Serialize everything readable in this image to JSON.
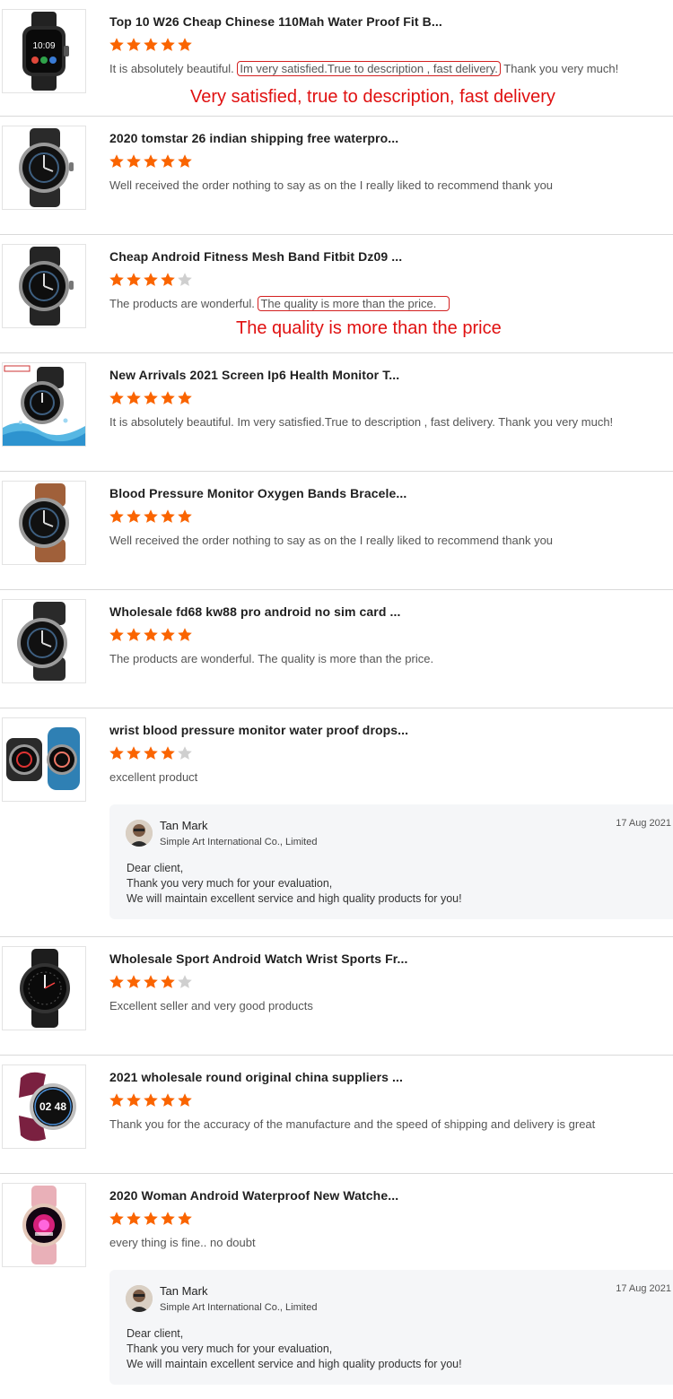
{
  "colors": {
    "star_on": "#fa6400",
    "star_off": "#cfcfcf",
    "annotation": "#e01010"
  },
  "reviews": [
    {
      "title": "Top 10 W26 Cheap Chinese 110Mah Water Proof Fit B...",
      "stars": 5,
      "comment_before": "It is absolutely beautiful. ",
      "comment_highlight": "Im very satisfied.True to description , fast delivery.",
      "comment_after": " Thank you very much!",
      "callout": "Very satisfied, true to description, fast delivery",
      "thumb_icon": "square-smartwatch-icon",
      "thumb_time": "10:09"
    },
    {
      "title": "2020 tomstar 26 indian shipping free waterpro...",
      "stars": 5,
      "comment": "Well received the order nothing to say as on the I really liked to recommend thank you",
      "thumb_icon": "round-smartwatch-icon"
    },
    {
      "title": "Cheap Android Fitness Mesh Band Fitbit Dz09 ...",
      "stars": 4,
      "comment_before": "The products are wonderful. ",
      "comment_highlight": "The quality is more than the price.",
      "comment_after": "",
      "callout": "The quality is more than the price",
      "thumb_icon": "round-smartwatch-icon"
    },
    {
      "title": "New Arrivals 2021 Screen Ip6 Health Monitor T...",
      "stars": 5,
      "comment": "It is absolutely beautiful. Im very satisfied.True to description , fast delivery. Thank you very much!",
      "thumb_icon": "waterproof-smartwatch-icon"
    },
    {
      "title": "Blood Pressure Monitor Oxygen Bands Bracele...",
      "stars": 5,
      "comment": "Well received the order nothing to say as on the I really liked to recommend thank you",
      "thumb_icon": "leather-strap-smartwatch-icon"
    },
    {
      "title": "Wholesale fd68 kw88 pro android no sim card ...",
      "stars": 5,
      "comment": "The products are wonderful. The quality is more than the price.",
      "thumb_icon": "round-smartwatch-icon"
    },
    {
      "title": "wrist blood pressure monitor water proof drops...",
      "stars": 4,
      "comment": "excellent product",
      "thumb_icon": "two-smartwatches-icon",
      "reply": {
        "name": "Tan Mark",
        "company": "Simple Art International Co., Limited",
        "date": "17 Aug 2021",
        "lines": [
          "Dear client,",
          "Thank you very much for your evaluation,",
          "We will maintain excellent service and high quality products for you!"
        ]
      }
    },
    {
      "title": "Wholesale Sport Android Watch Wrist Sports Fr...",
      "stars": 4,
      "comment": "Excellent seller and very good products",
      "thumb_icon": "black-round-smartwatch-icon"
    },
    {
      "title": "2021 wholesale round original china suppliers ...",
      "stars": 5,
      "comment": "Thank you for the accuracy of the manufacture and the speed of shipping and delivery is great",
      "thumb_icon": "purple-strap-smartwatch-icon",
      "thumb_time": "02 48"
    },
    {
      "title": "2020 Woman Android Waterproof New Watche...",
      "stars": 5,
      "comment": "every thing is fine.. no doubt",
      "thumb_icon": "pink-strap-smartwatch-icon",
      "reply": {
        "name": "Tan Mark",
        "company": "Simple Art International Co., Limited",
        "date": "17 Aug 2021",
        "lines": [
          "Dear client,",
          "Thank you very much for your evaluation,",
          "We will maintain excellent service and high quality products for you!"
        ]
      }
    }
  ]
}
